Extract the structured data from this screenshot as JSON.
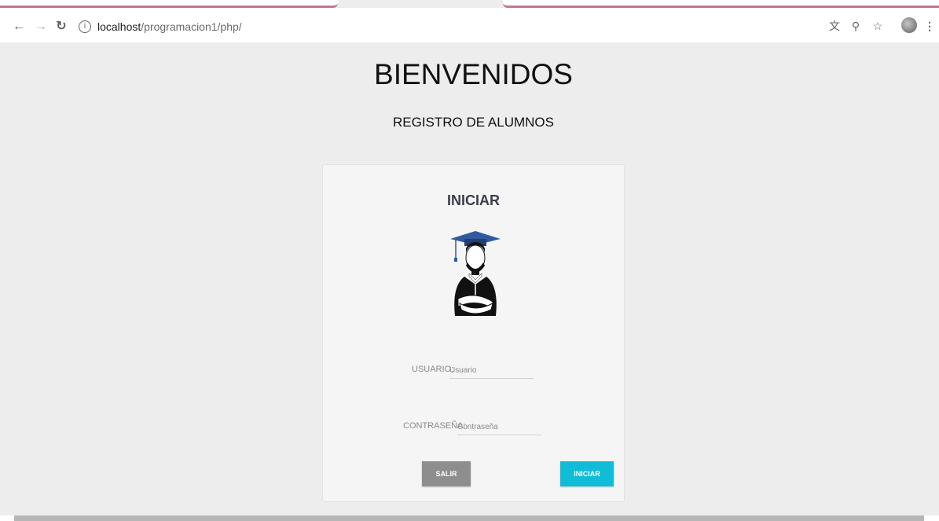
{
  "browser": {
    "url_host": "localhost",
    "url_path": "/programacion1/php/",
    "back_icon": "arrow-left-icon",
    "forward_icon": "arrow-right-icon",
    "reload_icon": "reload-icon",
    "info_icon": "info-icon",
    "translate_icon": "translate-icon",
    "zoom_icon": "zoom-icon",
    "bookmark_icon": "star-icon",
    "menu_icon": "kebab-menu-icon",
    "tab_accent": "#c4788c"
  },
  "page": {
    "title": "BIENVENIDOS",
    "subtitle": "REGISTRO DE ALUMNOS"
  },
  "login": {
    "heading": "INICIAR",
    "user_label": "USUARIO:",
    "user_placeholder": "Usuario",
    "password_label": "CONTRASEÑA:",
    "password_placeholder": "Contraseña",
    "exit_label": "SALIR",
    "submit_label": "INICIAR",
    "exit_color": "#8e8e8e",
    "submit_color": "#10bcd6",
    "illustration": "graduate-student-icon"
  }
}
